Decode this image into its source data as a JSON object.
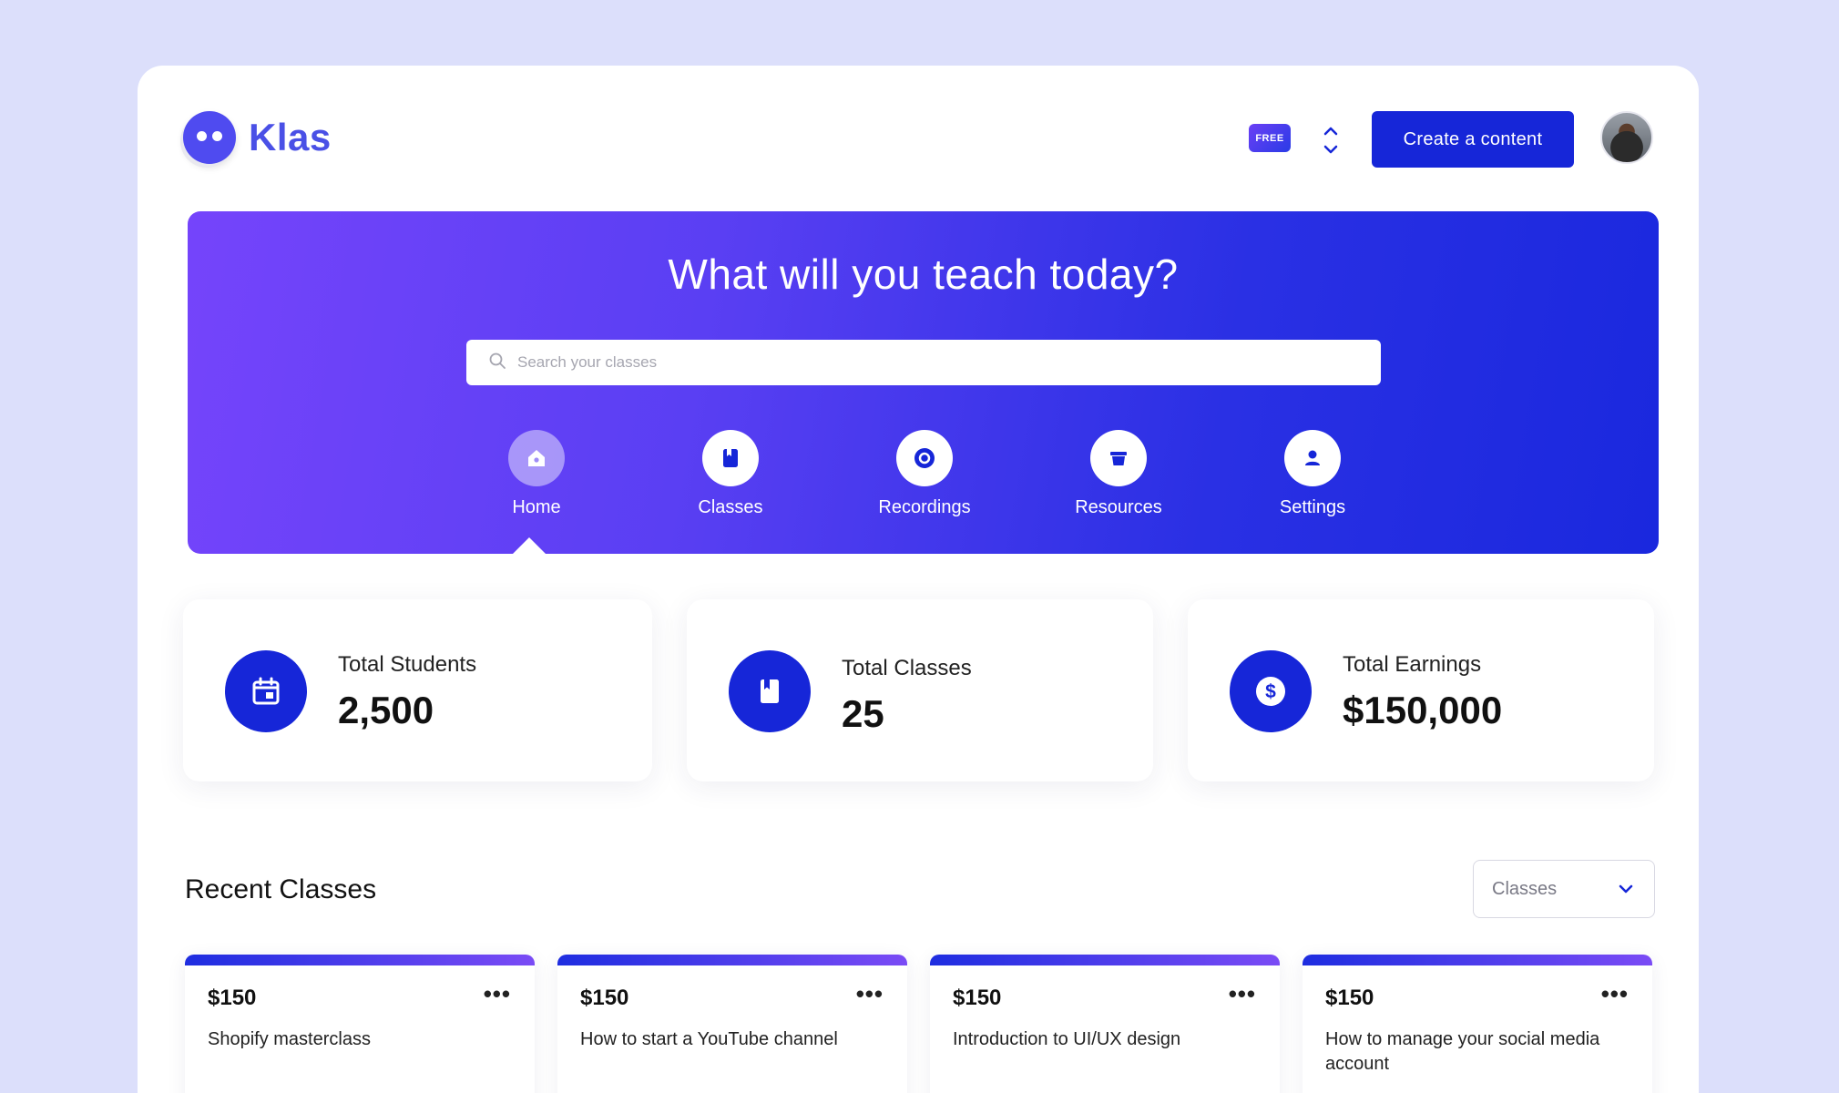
{
  "brand": {
    "name": "Klas"
  },
  "header": {
    "plan_badge": "FREE",
    "create_label": "Create a content"
  },
  "hero": {
    "title": "What will you teach today?",
    "search_placeholder": "Search your classes",
    "nav": [
      {
        "label": "Home",
        "icon": "home-icon",
        "active": true
      },
      {
        "label": "Classes",
        "icon": "book-icon",
        "active": false
      },
      {
        "label": "Recordings",
        "icon": "record-icon",
        "active": false
      },
      {
        "label": "Resources",
        "icon": "basket-icon",
        "active": false
      },
      {
        "label": "Settings",
        "icon": "user-icon",
        "active": false
      }
    ]
  },
  "stats": [
    {
      "label": "Total Students",
      "value": "2,500",
      "icon": "calendar-icon"
    },
    {
      "label": "Total Classes",
      "value": "25",
      "icon": "book-icon"
    },
    {
      "label": "Total Earnings",
      "value": "$150,000",
      "icon": "dollar-icon"
    }
  ],
  "recent": {
    "title": "Recent Classes",
    "filter_value": "Classes",
    "classes": [
      {
        "price": "$150",
        "title": "Shopify masterclass"
      },
      {
        "price": "$150",
        "title": "How to start a YouTube channel"
      },
      {
        "price": "$150",
        "title": "Introduction to UI/UX design"
      },
      {
        "price": "$150",
        "title": "How to manage your social media account"
      }
    ],
    "more_glyph": "•••"
  },
  "colors": {
    "background": "#dcdffb",
    "primary": "#1626d8",
    "brand_text": "#4a50e6",
    "hero_gradient_start": "#7544fb",
    "hero_gradient_end": "#1a28de"
  }
}
